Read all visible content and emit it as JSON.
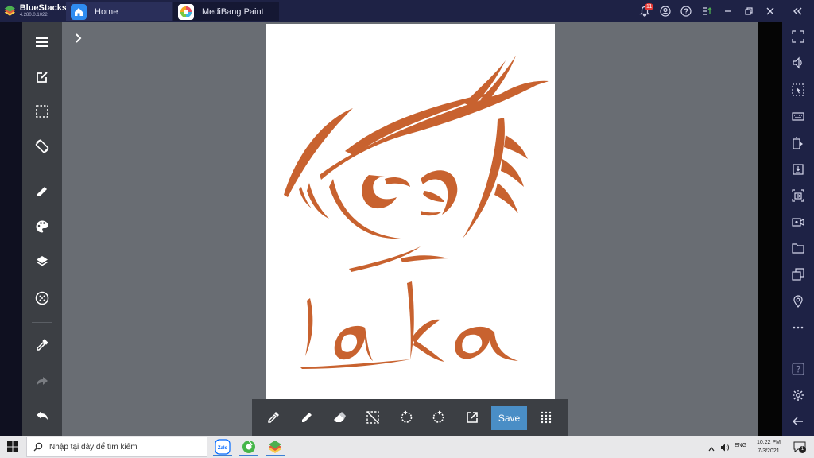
{
  "titlebar": {
    "app_name": "BlueStacks",
    "app_version": "4.280.0.1022",
    "tabs": [
      {
        "label": "Home",
        "icon": "home-icon"
      },
      {
        "label": "MediBang Paint",
        "icon": "medibang-icon"
      }
    ],
    "notification_count": "11",
    "window_icons": [
      "bell-icon",
      "account-icon",
      "help-icon",
      "sort-icon",
      "minimize-icon",
      "restore-icon",
      "close-icon",
      "collapse-sidebar-icon"
    ]
  },
  "left_toolbar": {
    "items": [
      "menu-icon",
      "edit-icon",
      "selection-icon",
      "rotate-canvas-icon",
      "brush-icon",
      "palette-icon",
      "layers-icon",
      "materials-icon",
      "eyedropper-icon",
      "redo-icon",
      "undo-icon"
    ]
  },
  "bottom_toolbar": {
    "items": [
      "eyedropper-icon",
      "pen-icon",
      "eraser-icon",
      "deselect-icon",
      "undo-icon",
      "redo-icon",
      "export-icon"
    ],
    "save_label": "Save",
    "grid_icon": "grid-icon"
  },
  "canvas": {
    "drawing_text": "Laka",
    "ink_color": "#c8622f"
  },
  "right_sidebar": {
    "items": [
      "fullscreen-icon",
      "volume-icon",
      "cursor-icon",
      "keyboard-icon",
      "install-apk-icon",
      "import-icon",
      "screenshot-icon",
      "record-icon",
      "folder-icon",
      "multi-instance-icon",
      "location-icon",
      "more-icon",
      "help-icon",
      "settings-icon",
      "back-icon"
    ]
  },
  "taskbar": {
    "search_placeholder": "Nhập tại đây để tìm kiếm",
    "apps": [
      "zalo-icon",
      "browser-icon",
      "bluestacks-icon"
    ],
    "language": "ENG",
    "time": "10:22 PM",
    "date": "7/3/2021",
    "notification_count": "1"
  },
  "colors": {
    "titlebar": "#1e2245",
    "toolbar": "#3c3f44",
    "canvas_bg": "#696d73",
    "save_button": "#4a8ec6",
    "ink": "#c8622f"
  }
}
